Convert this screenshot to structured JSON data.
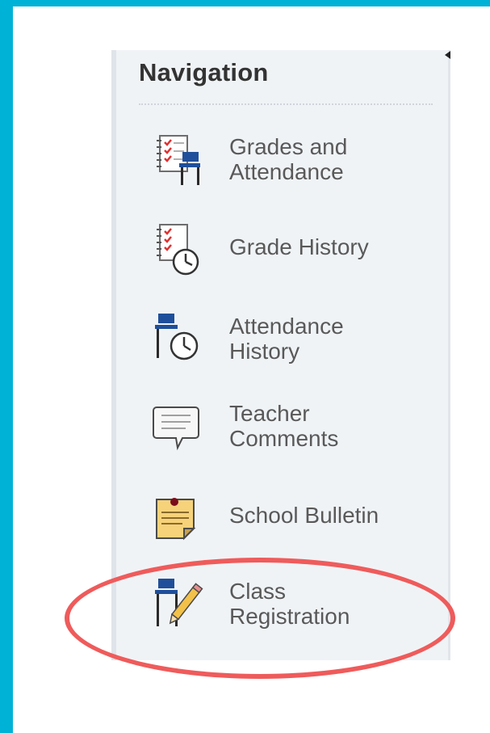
{
  "navigation": {
    "title": "Navigation",
    "items": [
      {
        "label": "Grades and\nAttendance",
        "icon": "grades-attendance-icon"
      },
      {
        "label": "Grade History",
        "icon": "grade-history-icon"
      },
      {
        "label": "Attendance\nHistory",
        "icon": "attendance-history-icon"
      },
      {
        "label": "Teacher\nComments",
        "icon": "teacher-comments-icon"
      },
      {
        "label": "School Bulletin",
        "icon": "school-bulletin-icon"
      },
      {
        "label": "Class\nRegistration",
        "icon": "class-registration-icon"
      }
    ]
  },
  "annotation": {
    "highlight_color": "#ef5b5b",
    "highlighted_item": "Class\nRegistration"
  },
  "colors": {
    "frame": "#00b2d6",
    "panel": "#f0f3f6",
    "label": "#595959",
    "icon_blue": "#1f4f9a"
  }
}
